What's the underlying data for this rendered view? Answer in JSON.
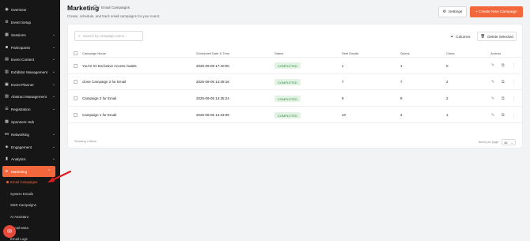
{
  "sidebar": {
    "items": [
      {
        "label": "Overview",
        "icon": "overview-icon",
        "glyph": "◉",
        "chevron": false
      },
      {
        "label": "Event Setup",
        "icon": "event-setup-icon",
        "glyph": "⚙",
        "chevron": false
      },
      {
        "label": "Sessions",
        "icon": "sessions-icon",
        "glyph": "▦",
        "chevron": true
      },
      {
        "label": "Participants",
        "icon": "participants-icon",
        "glyph": "☻",
        "chevron": true
      },
      {
        "label": "Event Content",
        "icon": "event-content-icon",
        "glyph": "▤",
        "chevron": true
      },
      {
        "label": "Exhibitor Management",
        "icon": "exhibitor-icon",
        "glyph": "▥",
        "chevron": true
      },
      {
        "label": "Event Planner",
        "icon": "event-planner-icon",
        "glyph": "▣",
        "chevron": true
      },
      {
        "label": "Abstract Management",
        "icon": "abstract-icon",
        "glyph": "▧",
        "chevron": true
      },
      {
        "label": "Registration",
        "icon": "registration-icon",
        "glyph": "☰",
        "chevron": true
      },
      {
        "label": "Sponsors Hub",
        "icon": "sponsors-icon",
        "glyph": "▩",
        "chevron": false
      },
      {
        "label": "Networking",
        "icon": "networking-icon",
        "glyph": "⋈",
        "chevron": true
      },
      {
        "label": "Engagement",
        "icon": "engagement-icon",
        "glyph": "◈",
        "chevron": true
      },
      {
        "label": "Analytics",
        "icon": "analytics-icon",
        "glyph": "▮",
        "chevron": true
      },
      {
        "label": "Marketing",
        "icon": "marketing-icon",
        "glyph": "➤",
        "chevron": true,
        "active": true
      }
    ],
    "subitems": [
      {
        "label": "Email Campaigns",
        "active": true
      },
      {
        "label": "System Emails"
      },
      {
        "label": "SMS Campaigns"
      },
      {
        "label": "AI Assistant"
      },
      {
        "label": "Social Meta"
      },
      {
        "label": "Email Logs"
      }
    ],
    "accent_color": "#f2683c"
  },
  "header": {
    "title": "Marketing",
    "breadcrumb": "Email Campaigns",
    "subtitle": "Create, schedule, and track email campaigns for your event.",
    "settings_label": "Settings",
    "create_label": "+ Create New Campaign"
  },
  "toolbar": {
    "search_placeholder": "Search by campaign name...",
    "columns_label": "Columns",
    "delete_label": "Delete Selected"
  },
  "table": {
    "headers": [
      "Campaign Name",
      "Scheduled Date & Time",
      "Status",
      "Sent Emails",
      "Opens",
      "Clicks",
      "Actions"
    ],
    "rows": [
      {
        "name": "You're In! Exclusive Access Awaits",
        "date": "2025-09-08 17:40:00",
        "status": "COMPLETED",
        "sent": "1",
        "opens": "1",
        "clicks": "0"
      },
      {
        "name": "clone Campaign 2 for Email",
        "date": "2025-09-05 14:39:16",
        "status": "COMPLETED",
        "sent": "7",
        "opens": "7",
        "clicks": "2"
      },
      {
        "name": "Campaign 2 for Email",
        "date": "2025-09-05 14:35:24",
        "status": "COMPLETED",
        "sent": "9",
        "opens": "9",
        "clicks": "2"
      },
      {
        "name": "Campaign 1 for Email",
        "date": "2025-09-05 14:33:09",
        "status": "COMPLETED",
        "sent": "10",
        "opens": "2",
        "clicks": "1"
      }
    ],
    "status_color": "#2e8b3e"
  },
  "footer": {
    "showing": "Showing 4 items",
    "per_page_label": "Items per page:",
    "per_page_value": "10"
  },
  "fab_icon": "chat-icon"
}
